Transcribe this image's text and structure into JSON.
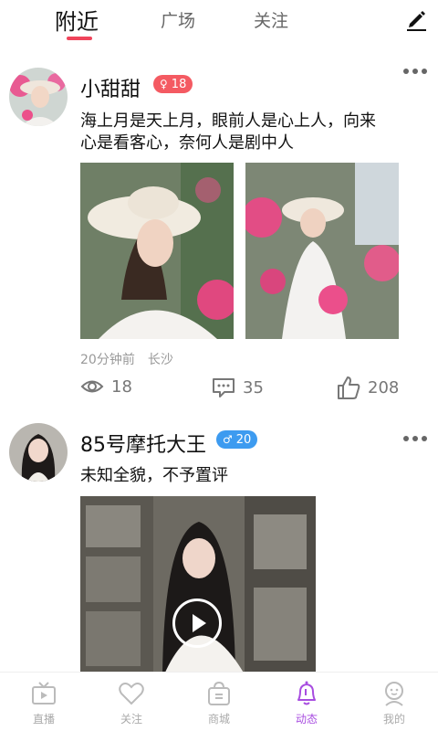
{
  "tabs": [
    {
      "label": "附近",
      "active": true
    },
    {
      "label": "广场",
      "active": false
    },
    {
      "label": "关注",
      "active": false
    }
  ],
  "colors": {
    "accent": "#f0445b",
    "nav_active": "#a84de0",
    "badge_pink": "#f45a62",
    "badge_blue": "#3d9bf0"
  },
  "posts": [
    {
      "username": "小甜甜",
      "badge": {
        "icon": "female-icon",
        "value": "18"
      },
      "text_line1": "海上月是天上月，眼前人是心上人，向来",
      "text_line2": "心是看客心，奈何人是剧中人",
      "time": "20分钟前",
      "location": "长沙",
      "views": "18",
      "comments": "35",
      "likes": "208"
    },
    {
      "username": "85号摩托大王",
      "badge": {
        "icon": "male-icon",
        "value": "20"
      },
      "text": "未知全貌，不予置评"
    }
  ],
  "bottom_nav": [
    {
      "label": "直播",
      "icon": "tv-icon"
    },
    {
      "label": "关注",
      "icon": "heart-icon"
    },
    {
      "label": "商城",
      "icon": "shop-bag-icon"
    },
    {
      "label": "动态",
      "icon": "bell-icon",
      "active": true
    },
    {
      "label": "我的",
      "icon": "profile-icon"
    }
  ]
}
